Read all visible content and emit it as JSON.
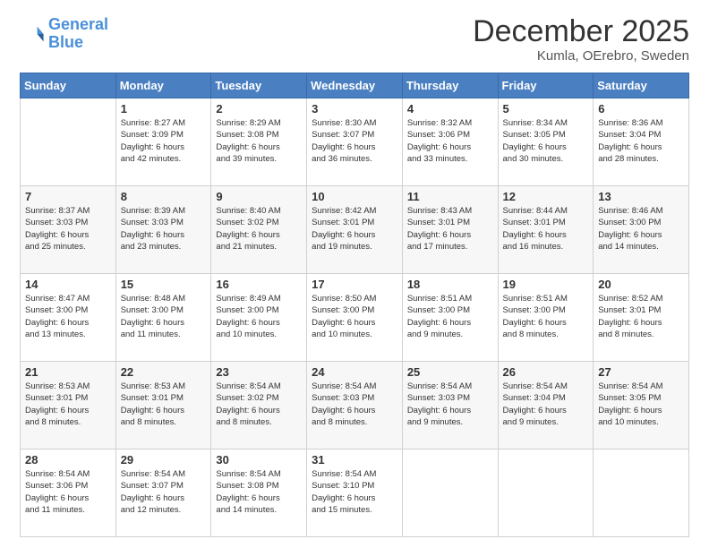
{
  "header": {
    "logo_line1": "General",
    "logo_line2": "Blue",
    "month_title": "December 2025",
    "location": "Kumla, OErebro, Sweden"
  },
  "weekdays": [
    "Sunday",
    "Monday",
    "Tuesday",
    "Wednesday",
    "Thursday",
    "Friday",
    "Saturday"
  ],
  "weeks": [
    [
      {
        "day": "",
        "text": ""
      },
      {
        "day": "1",
        "text": "Sunrise: 8:27 AM\nSunset: 3:09 PM\nDaylight: 6 hours\nand 42 minutes."
      },
      {
        "day": "2",
        "text": "Sunrise: 8:29 AM\nSunset: 3:08 PM\nDaylight: 6 hours\nand 39 minutes."
      },
      {
        "day": "3",
        "text": "Sunrise: 8:30 AM\nSunset: 3:07 PM\nDaylight: 6 hours\nand 36 minutes."
      },
      {
        "day": "4",
        "text": "Sunrise: 8:32 AM\nSunset: 3:06 PM\nDaylight: 6 hours\nand 33 minutes."
      },
      {
        "day": "5",
        "text": "Sunrise: 8:34 AM\nSunset: 3:05 PM\nDaylight: 6 hours\nand 30 minutes."
      },
      {
        "day": "6",
        "text": "Sunrise: 8:36 AM\nSunset: 3:04 PM\nDaylight: 6 hours\nand 28 minutes."
      }
    ],
    [
      {
        "day": "7",
        "text": "Sunrise: 8:37 AM\nSunset: 3:03 PM\nDaylight: 6 hours\nand 25 minutes."
      },
      {
        "day": "8",
        "text": "Sunrise: 8:39 AM\nSunset: 3:03 PM\nDaylight: 6 hours\nand 23 minutes."
      },
      {
        "day": "9",
        "text": "Sunrise: 8:40 AM\nSunset: 3:02 PM\nDaylight: 6 hours\nand 21 minutes."
      },
      {
        "day": "10",
        "text": "Sunrise: 8:42 AM\nSunset: 3:01 PM\nDaylight: 6 hours\nand 19 minutes."
      },
      {
        "day": "11",
        "text": "Sunrise: 8:43 AM\nSunset: 3:01 PM\nDaylight: 6 hours\nand 17 minutes."
      },
      {
        "day": "12",
        "text": "Sunrise: 8:44 AM\nSunset: 3:01 PM\nDaylight: 6 hours\nand 16 minutes."
      },
      {
        "day": "13",
        "text": "Sunrise: 8:46 AM\nSunset: 3:00 PM\nDaylight: 6 hours\nand 14 minutes."
      }
    ],
    [
      {
        "day": "14",
        "text": "Sunrise: 8:47 AM\nSunset: 3:00 PM\nDaylight: 6 hours\nand 13 minutes."
      },
      {
        "day": "15",
        "text": "Sunrise: 8:48 AM\nSunset: 3:00 PM\nDaylight: 6 hours\nand 11 minutes."
      },
      {
        "day": "16",
        "text": "Sunrise: 8:49 AM\nSunset: 3:00 PM\nDaylight: 6 hours\nand 10 minutes."
      },
      {
        "day": "17",
        "text": "Sunrise: 8:50 AM\nSunset: 3:00 PM\nDaylight: 6 hours\nand 10 minutes."
      },
      {
        "day": "18",
        "text": "Sunrise: 8:51 AM\nSunset: 3:00 PM\nDaylight: 6 hours\nand 9 minutes."
      },
      {
        "day": "19",
        "text": "Sunrise: 8:51 AM\nSunset: 3:00 PM\nDaylight: 6 hours\nand 8 minutes."
      },
      {
        "day": "20",
        "text": "Sunrise: 8:52 AM\nSunset: 3:01 PM\nDaylight: 6 hours\nand 8 minutes."
      }
    ],
    [
      {
        "day": "21",
        "text": "Sunrise: 8:53 AM\nSunset: 3:01 PM\nDaylight: 6 hours\nand 8 minutes."
      },
      {
        "day": "22",
        "text": "Sunrise: 8:53 AM\nSunset: 3:01 PM\nDaylight: 6 hours\nand 8 minutes."
      },
      {
        "day": "23",
        "text": "Sunrise: 8:54 AM\nSunset: 3:02 PM\nDaylight: 6 hours\nand 8 minutes."
      },
      {
        "day": "24",
        "text": "Sunrise: 8:54 AM\nSunset: 3:03 PM\nDaylight: 6 hours\nand 8 minutes."
      },
      {
        "day": "25",
        "text": "Sunrise: 8:54 AM\nSunset: 3:03 PM\nDaylight: 6 hours\nand 9 minutes."
      },
      {
        "day": "26",
        "text": "Sunrise: 8:54 AM\nSunset: 3:04 PM\nDaylight: 6 hours\nand 9 minutes."
      },
      {
        "day": "27",
        "text": "Sunrise: 8:54 AM\nSunset: 3:05 PM\nDaylight: 6 hours\nand 10 minutes."
      }
    ],
    [
      {
        "day": "28",
        "text": "Sunrise: 8:54 AM\nSunset: 3:06 PM\nDaylight: 6 hours\nand 11 minutes."
      },
      {
        "day": "29",
        "text": "Sunrise: 8:54 AM\nSunset: 3:07 PM\nDaylight: 6 hours\nand 12 minutes."
      },
      {
        "day": "30",
        "text": "Sunrise: 8:54 AM\nSunset: 3:08 PM\nDaylight: 6 hours\nand 14 minutes."
      },
      {
        "day": "31",
        "text": "Sunrise: 8:54 AM\nSunset: 3:10 PM\nDaylight: 6 hours\nand 15 minutes."
      },
      {
        "day": "",
        "text": ""
      },
      {
        "day": "",
        "text": ""
      },
      {
        "day": "",
        "text": ""
      }
    ]
  ]
}
